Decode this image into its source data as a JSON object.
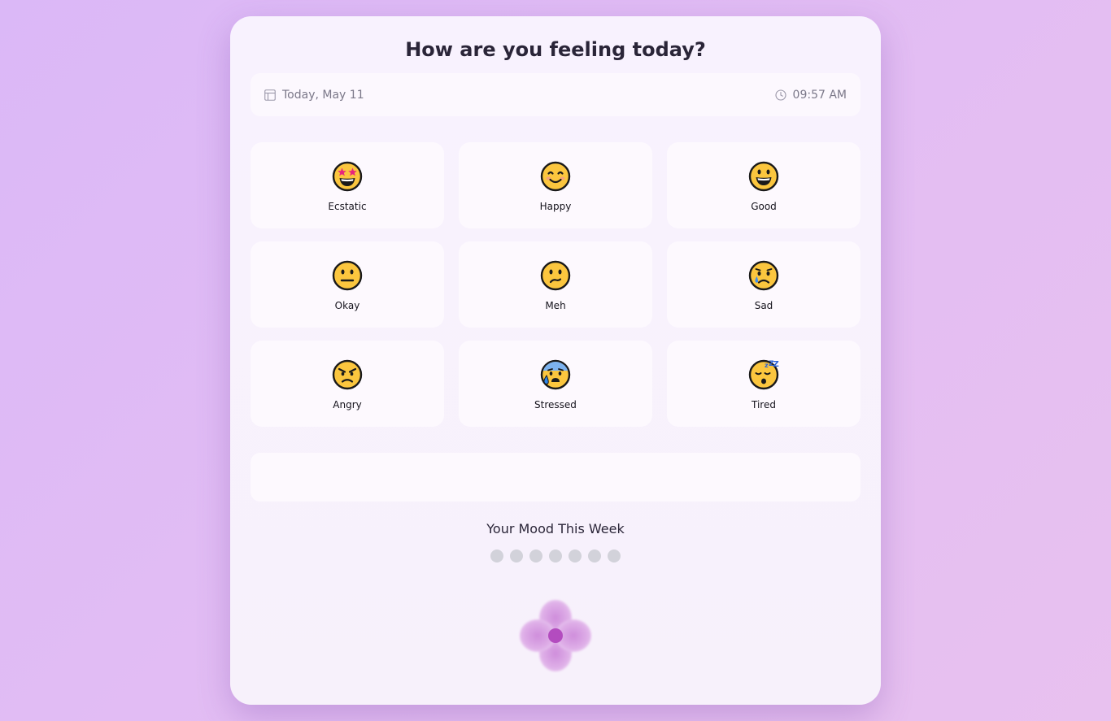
{
  "header": {
    "title": "How are you feeling today?"
  },
  "datebar": {
    "date_text": "Today, May 11",
    "date_icon": "calendar-icon",
    "time_text": "09:57 AM",
    "time_icon": "clock-icon"
  },
  "moods": [
    {
      "label": "Ecstatic",
      "icon": "star-struck-face-icon"
    },
    {
      "label": "Happy",
      "icon": "smiling-face-icon"
    },
    {
      "label": "Good",
      "icon": "grinning-face-icon"
    },
    {
      "label": "Okay",
      "icon": "neutral-face-icon"
    },
    {
      "label": "Meh",
      "icon": "confused-face-icon"
    },
    {
      "label": "Sad",
      "icon": "crying-face-icon"
    },
    {
      "label": "Angry",
      "icon": "angry-face-icon"
    },
    {
      "label": "Stressed",
      "icon": "anxious-sweat-face-icon"
    },
    {
      "label": "Tired",
      "icon": "sleeping-face-icon"
    }
  ],
  "note": {
    "value": ""
  },
  "week": {
    "title": "Your Mood This Week",
    "days_count_shown": 7
  },
  "colors": {
    "background": "#dbb8f7",
    "card": "#f8f2fe",
    "tile": "#fdf9fe",
    "emoji_face": "#fbc63e",
    "empty_dot": "#d2d2da",
    "flower_center": "#b34cbf"
  }
}
